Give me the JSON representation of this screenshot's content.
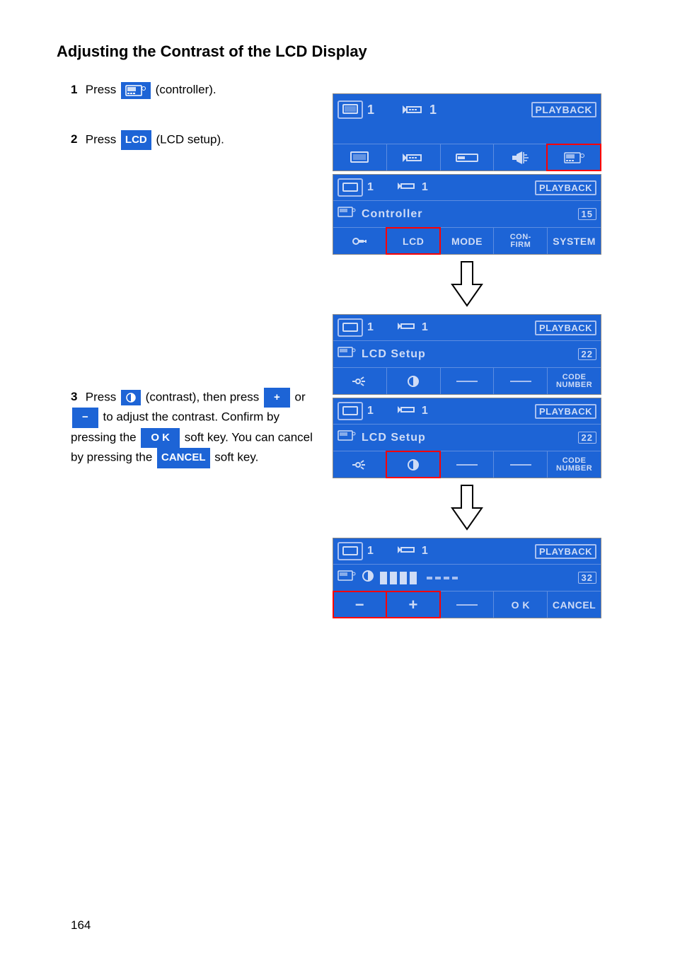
{
  "title": "Adjusting the Contrast of the LCD Display",
  "steps": {
    "s1": {
      "num": "1",
      "pre": "Press ",
      "post": " (controller)."
    },
    "s2": {
      "num": "2",
      "pre": "Press ",
      "btn": "LCD",
      "post": " (LCD setup)."
    },
    "s3": {
      "num": "3",
      "pre": "Press ",
      "mid": " (contrast), then press ",
      "plus": "+",
      "or_text": " or ",
      "minus": "−",
      "post": " to adjust the contrast. Confirm by pressing the ",
      "ok": "O K",
      "after_ok": " soft key. You can cancel by pressing the ",
      "cancel": "CANCEL",
      "after_cancel": " soft key."
    }
  },
  "lcd": {
    "top": {
      "monitor_num": "1",
      "cam_num": "1",
      "badge": "PLAYBACK"
    },
    "panel1": {
      "title": "Controller",
      "code": "15",
      "cells": [
        "LCD",
        "MODE",
        "CON-FIRM",
        "SYSTEM"
      ]
    },
    "panel2": {
      "title": "LCD Setup",
      "code": "22",
      "last": "CODE NUMBER"
    },
    "panel3": {
      "title": "LCD Setup",
      "code": "22",
      "last": "CODE NUMBER"
    },
    "panel4": {
      "code": "32",
      "cells": [
        "−",
        "+",
        "O K",
        "CANCEL"
      ]
    }
  },
  "page_number": "164"
}
